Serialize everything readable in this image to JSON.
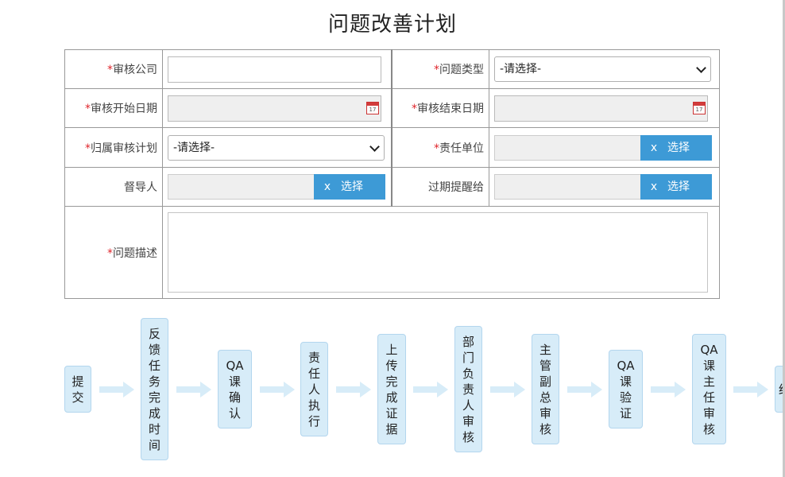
{
  "page": {
    "title": "问题改善计划"
  },
  "form": {
    "required_mark": "*",
    "audit_company": {
      "label": "审核公司",
      "value": ""
    },
    "issue_type": {
      "label": "问题类型",
      "selected": "-请选择-"
    },
    "audit_start_date": {
      "label": "审核开始日期",
      "value": ""
    },
    "audit_end_date": {
      "label": "审核结束日期",
      "value": ""
    },
    "audit_plan": {
      "label": "归属审核计划",
      "selected": "-请选择-"
    },
    "responsible_unit": {
      "label": "责任单位",
      "clear": "x",
      "select": "选择"
    },
    "supervisor": {
      "label": "督导人",
      "clear": "x",
      "select": "选择"
    },
    "expiry_reminder": {
      "label": "过期提醒给",
      "clear": "x",
      "select": "选择"
    },
    "issue_description": {
      "label": "问题描述",
      "value": ""
    },
    "calendar_icon_text": "17"
  },
  "flow": {
    "steps": [
      "提交",
      "反馈任务完成时间",
      "QA课确认",
      "责任人执行",
      "上传完成证据",
      "部门负责人审核",
      "主管副总审核",
      "QA课验证",
      "QA课主任审核",
      "结"
    ]
  },
  "colors": {
    "accent": "#3d9ad6",
    "required": "#e0252b",
    "node_bg": "#d7ecf8"
  }
}
